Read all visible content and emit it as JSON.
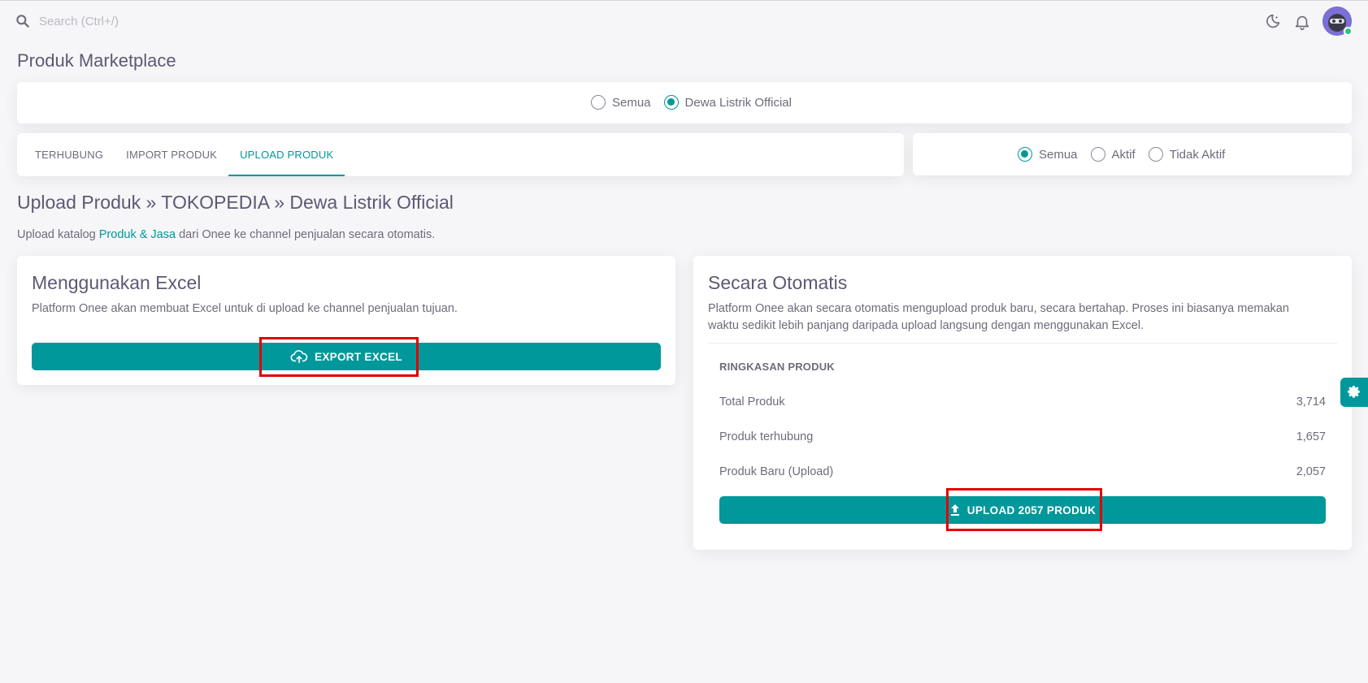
{
  "search": {
    "placeholder": "Search (Ctrl+/)"
  },
  "page": {
    "title": "Produk Marketplace"
  },
  "store_filter": {
    "options": [
      {
        "label": "Semua",
        "selected": false
      },
      {
        "label": "Dewa Listrik Official",
        "selected": true
      }
    ]
  },
  "tabs": [
    {
      "label": "TERHUBUNG",
      "active": false
    },
    {
      "label": "IMPORT PRODUK",
      "active": false
    },
    {
      "label": "UPLOAD PRODUK",
      "active": true
    }
  ],
  "status_filter": {
    "options": [
      {
        "label": "Semua",
        "selected": true
      },
      {
        "label": "Aktif",
        "selected": false
      },
      {
        "label": "Tidak Aktif",
        "selected": false
      }
    ]
  },
  "section": {
    "heading": "Upload Produk » TOKOPEDIA » Dewa Listrik Official",
    "subtitle_pre": "Upload katalog ",
    "subtitle_link": "Produk & Jasa",
    "subtitle_post": " dari Onee ke channel penjualan secara otomatis."
  },
  "excel_card": {
    "title": "Menggunakan Excel",
    "text": "Platform Onee akan membuat Excel untuk di upload ke channel penjualan tujuan.",
    "button": "EXPORT EXCEL"
  },
  "auto_card": {
    "title": "Secara Otomatis",
    "text_line1": "Platform Onee akan secara otomatis mengupload produk baru, secara bertahap. Proses ini biasanya memakan",
    "text_line2": "waktu sedikit lebih panjang daripada upload langsung dengan menggunakan Excel.",
    "summary_heading": "RINGKASAN PRODUK",
    "rows": [
      {
        "label": "Total Produk",
        "value": "3,714"
      },
      {
        "label": "Produk terhubung",
        "value": "1,657"
      },
      {
        "label": "Produk Baru (Upload)",
        "value": "2,057"
      }
    ],
    "button": "UPLOAD 2057 PRODUK"
  },
  "colors": {
    "accent": "#00989a",
    "highlight": "#e00000",
    "online": "#28c76f"
  },
  "icons": [
    "search-icon",
    "moon-icon",
    "bell-icon",
    "cloud-upload-icon",
    "upload-icon",
    "gear-icon"
  ]
}
